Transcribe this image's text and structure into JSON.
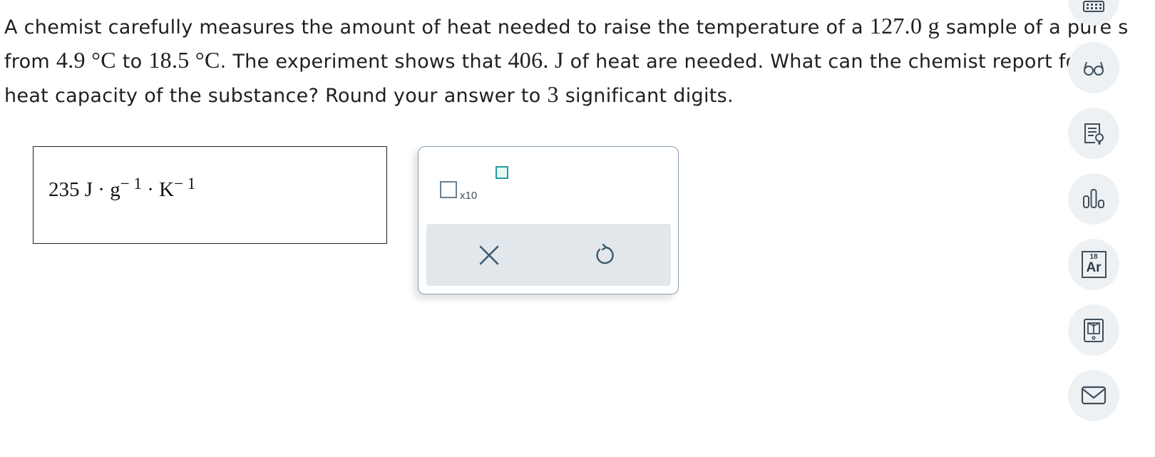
{
  "question": {
    "line1": [
      {
        "t": "A chemist carefully measures the amount of heat needed to raise the temperature of a "
      },
      {
        "t": "127.0 g",
        "math": true
      },
      {
        "t": " sample of a pure s"
      }
    ],
    "line2": [
      {
        "t": "from "
      },
      {
        "t": "4.9 °C",
        "math": true
      },
      {
        "t": " to "
      },
      {
        "t": "18.5 °C",
        "math": true
      },
      {
        "t": ". The experiment shows that "
      },
      {
        "t": "406. J",
        "math": true
      },
      {
        "t": " of heat are needed. What can the chemist report for th"
      }
    ],
    "line3": [
      {
        "t": "heat capacity of the substance? Round your answer to "
      },
      {
        "t": "3",
        "math": true
      },
      {
        "t": " significant digits."
      }
    ]
  },
  "answer": {
    "value": "235",
    "unit_j": "J",
    "dot": "·",
    "unit_g": "g",
    "exp_g": "− 1",
    "unit_k": "K",
    "exp_k": "− 1"
  },
  "keypad": {
    "sci_label": "x10",
    "clear_icon": "close-icon",
    "undo_icon": "undo-icon"
  },
  "toolbar": {
    "icons": [
      "calculator-icon",
      "glasses-icon",
      "lightbulb-hint-icon",
      "bar-chart-icon",
      "periodic-table-icon",
      "ebook-icon",
      "mail-icon"
    ],
    "periodic_tile": {
      "number": "18",
      "symbol": "Ar"
    }
  },
  "colors": {
    "keypad_border": "#8aa0b4",
    "keypad_bar": "#e1e7eb",
    "accent_teal": "#2b9a9c",
    "toolbar_bg": "#eef1f3",
    "icon_color": "#3f4f5c"
  }
}
